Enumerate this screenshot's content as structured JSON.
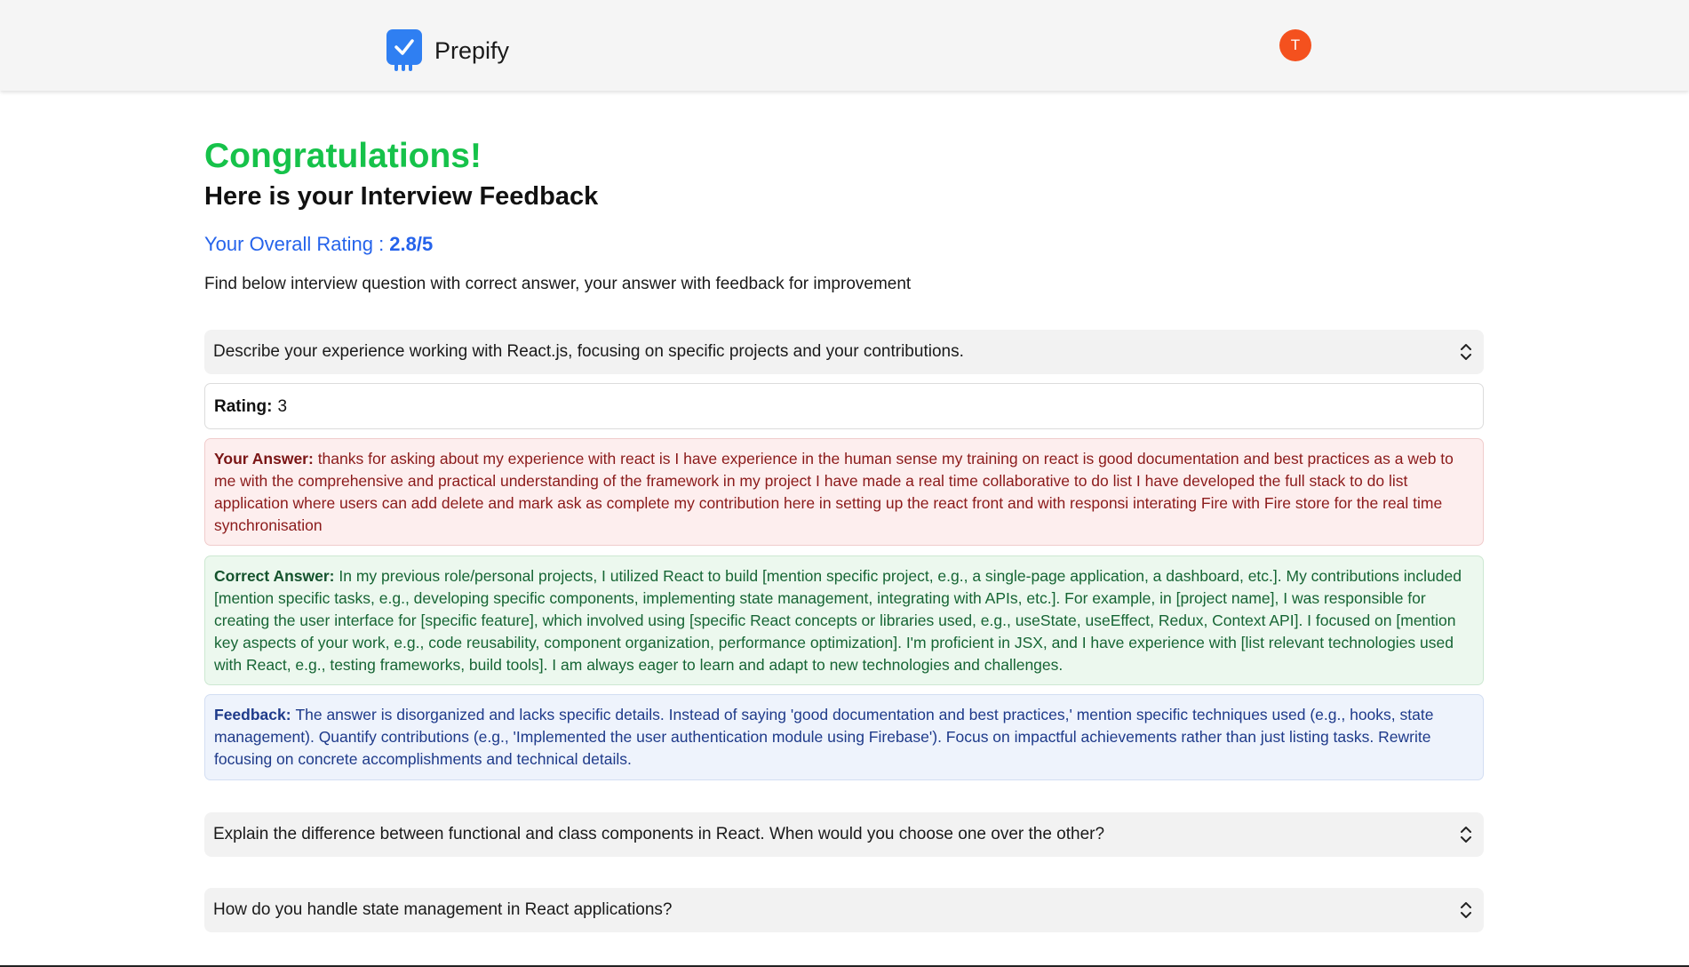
{
  "header": {
    "logo_text": "Prepify",
    "logo_icon": "check-icon",
    "avatar_initial": "T",
    "avatar_color": "#f4511e",
    "brand_color": "#2f7ff2"
  },
  "page": {
    "congrats": "Congratulations!",
    "subtitle": "Here is your Interview Feedback",
    "rating_label": "Your Overall Rating : ",
    "rating_value": "2.8/5",
    "intro": "Find below interview question with correct answer, your answer with feedback for improvement"
  },
  "questions": [
    {
      "text": "Describe your experience working with React.js, focusing on specific projects and your contributions.",
      "expanded": true,
      "rating_label": "Rating:",
      "rating": "3",
      "answer_label": "Your Answer:",
      "answer": "thanks for asking about my experience with react is I have experience in the human sense my training on react is good documentation and best practices as a web to me with the comprehensive and practical understanding of the framework in my project I have made a real time collaborative to do list I have developed the full stack to do list application where users can add delete and mark ask as complete my contribution here in setting up the react front and with responsi interating Fire with Fire store for the real time synchronisation",
      "correct_label": "Correct Answer:",
      "correct": "In my previous role/personal projects, I utilized React to build [mention specific project, e.g., a single-page application, a dashboard, etc.]. My contributions included [mention specific tasks, e.g., developing specific components, implementing state management, integrating with APIs, etc.]. For example, in [project name], I was responsible for creating the user interface for [specific feature], which involved using [specific React concepts or libraries used, e.g., useState, useEffect, Redux, Context API]. I focused on [mention key aspects of your work, e.g., code reusability, component organization, performance optimization]. I'm proficient in JSX, and I have experience with [list relevant technologies used with React, e.g., testing frameworks, build tools]. I am always eager to learn and adapt to new technologies and challenges.",
      "feedback_label": "Feedback:",
      "feedback": "The answer is disorganized and lacks specific details. Instead of saying 'good documentation and best practices,' mention specific techniques used (e.g., hooks, state management). Quantify contributions (e.g., 'Implemented the user authentication module using Firebase'). Focus on impactful achievements rather than just listing tasks. Rewrite focusing on concrete accomplishments and technical details."
    },
    {
      "text": "Explain the difference between functional and class components in React. When would you choose one over the other?",
      "expanded": false
    },
    {
      "text": "How do you handle state management in React applications?",
      "expanded": false
    }
  ]
}
